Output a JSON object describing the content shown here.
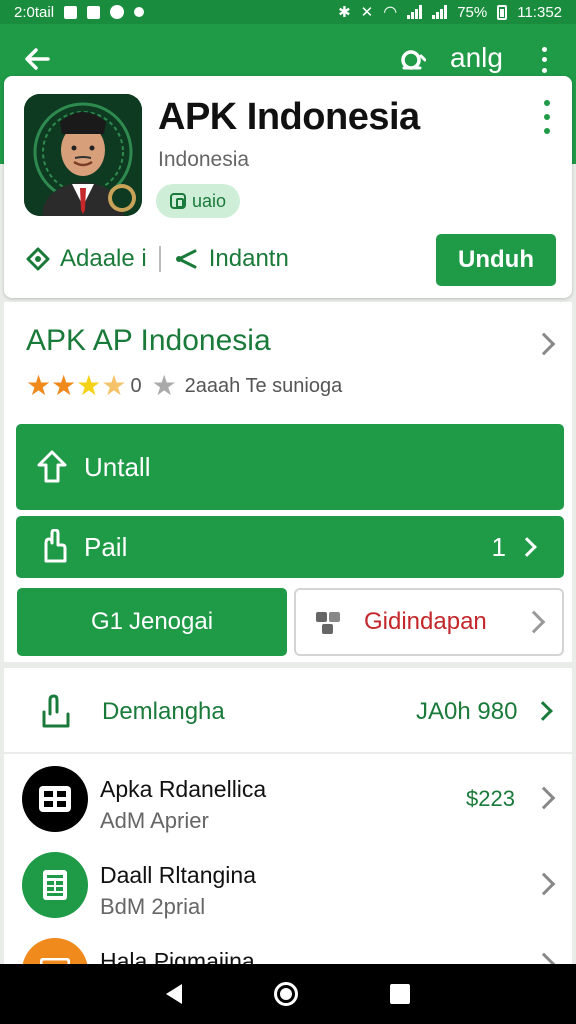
{
  "status_bar": {
    "left_text": "2:0tail",
    "battery": "75%",
    "time": "11:352"
  },
  "app_bar": {
    "action_text": "anlg"
  },
  "app": {
    "title": "APK Indonesia",
    "subtitle": "Indonesia",
    "badge": "uaio",
    "meta_left": "Adaale i",
    "meta_right": "Indantn",
    "download_label": "Unduh"
  },
  "info": {
    "title": "APK AP Indonesia",
    "rating_count": "0",
    "rating_text": "2aaah Te sunioga",
    "rating_value": 3.5,
    "rating_max": 5,
    "install_label": "Untall",
    "pail_label": "Pail",
    "pail_count": "1",
    "jenogai_label": "Jenogai",
    "jenogai_prefix": "G1",
    "outline_label": "Gidindapan"
  },
  "download_row": {
    "label": "Demlangha",
    "value": "JA0h 980"
  },
  "list": [
    {
      "title": "Apka Rdanellica",
      "subtitle": "AdM  Aprier",
      "price": "$223",
      "icon": "grid-icon",
      "color": "#000000"
    },
    {
      "title": "Daall Rltangina",
      "subtitle": "BdM  2prial",
      "price": "",
      "icon": "sheet-icon",
      "color": "#1f9a47"
    },
    {
      "title": "Hala Pigmaiina",
      "subtitle": "",
      "price": "",
      "icon": "app-icon",
      "color": "#f08a1c"
    }
  ],
  "colors": {
    "primary": "#1f9a47",
    "accent_red": "#c3272b"
  }
}
